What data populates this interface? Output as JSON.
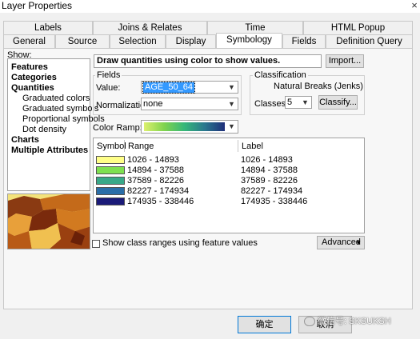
{
  "window": {
    "title": "Layer Properties",
    "close_glyph": "×"
  },
  "tabs_row1": [
    "Labels",
    "Joins & Relates",
    "Time",
    "HTML Popup"
  ],
  "tabs_row2": [
    "General",
    "Source",
    "Selection",
    "Display",
    "Symbology",
    "Fields",
    "Definition Query"
  ],
  "active_tab": "Symbology",
  "show": {
    "label": "Show:",
    "items": [
      {
        "label": "Features",
        "bold": true
      },
      {
        "label": "Categories",
        "bold": true
      },
      {
        "label": "Quantities",
        "bold": true
      },
      {
        "label": "Graduated colors",
        "bold": false
      },
      {
        "label": "Graduated symbols",
        "bold": false
      },
      {
        "label": "Proportional symbols",
        "bold": false
      },
      {
        "label": "Dot density",
        "bold": false
      },
      {
        "label": "Charts",
        "bold": true
      },
      {
        "label": "Multiple Attributes",
        "bold": true
      }
    ]
  },
  "draw_text": "Draw quantities using color to show values.",
  "import_button": "Import...",
  "fields": {
    "group_label": "Fields",
    "value_label": "Value:",
    "value": "AGE_50_64",
    "normalization_label": "Normalization:",
    "normalization": "none"
  },
  "classification": {
    "group_label": "Classification",
    "method": "Natural Breaks (Jenks)",
    "classes_label": "Classes:",
    "classes": "5",
    "classify_button": "Classify..."
  },
  "color_ramp_label": "Color Ramp:",
  "color_ramp": [
    "#dcf06e",
    "#7fd34e",
    "#35b779",
    "#2a788e",
    "#1f2f7a"
  ],
  "table": {
    "headers": {
      "symbol": "Symbol",
      "range": "Range",
      "label": "Label"
    },
    "rows": [
      {
        "color": "#ffff88",
        "range": "1026 - 14893",
        "label": "1026 - 14893"
      },
      {
        "color": "#7ee050",
        "color_name": "green",
        "range": "14894 - 37588",
        "label": "14894 - 37588"
      },
      {
        "color": "#38a888",
        "range": "37589 - 82226",
        "label": "37589 - 82226"
      },
      {
        "color": "#2a6ea8",
        "range": "82227 - 174934",
        "label": "82227 - 174934"
      },
      {
        "color": "#1a1a78",
        "range": "174935 - 338446",
        "label": "174935 - 338446"
      }
    ]
  },
  "show_class_ranges": {
    "label": "Show class ranges using feature values",
    "checked": false
  },
  "advanced_button": "Advanced",
  "footer": {
    "ok": "确定",
    "cancel": "取消",
    "watermark": "微信号: SKSUKSH"
  }
}
